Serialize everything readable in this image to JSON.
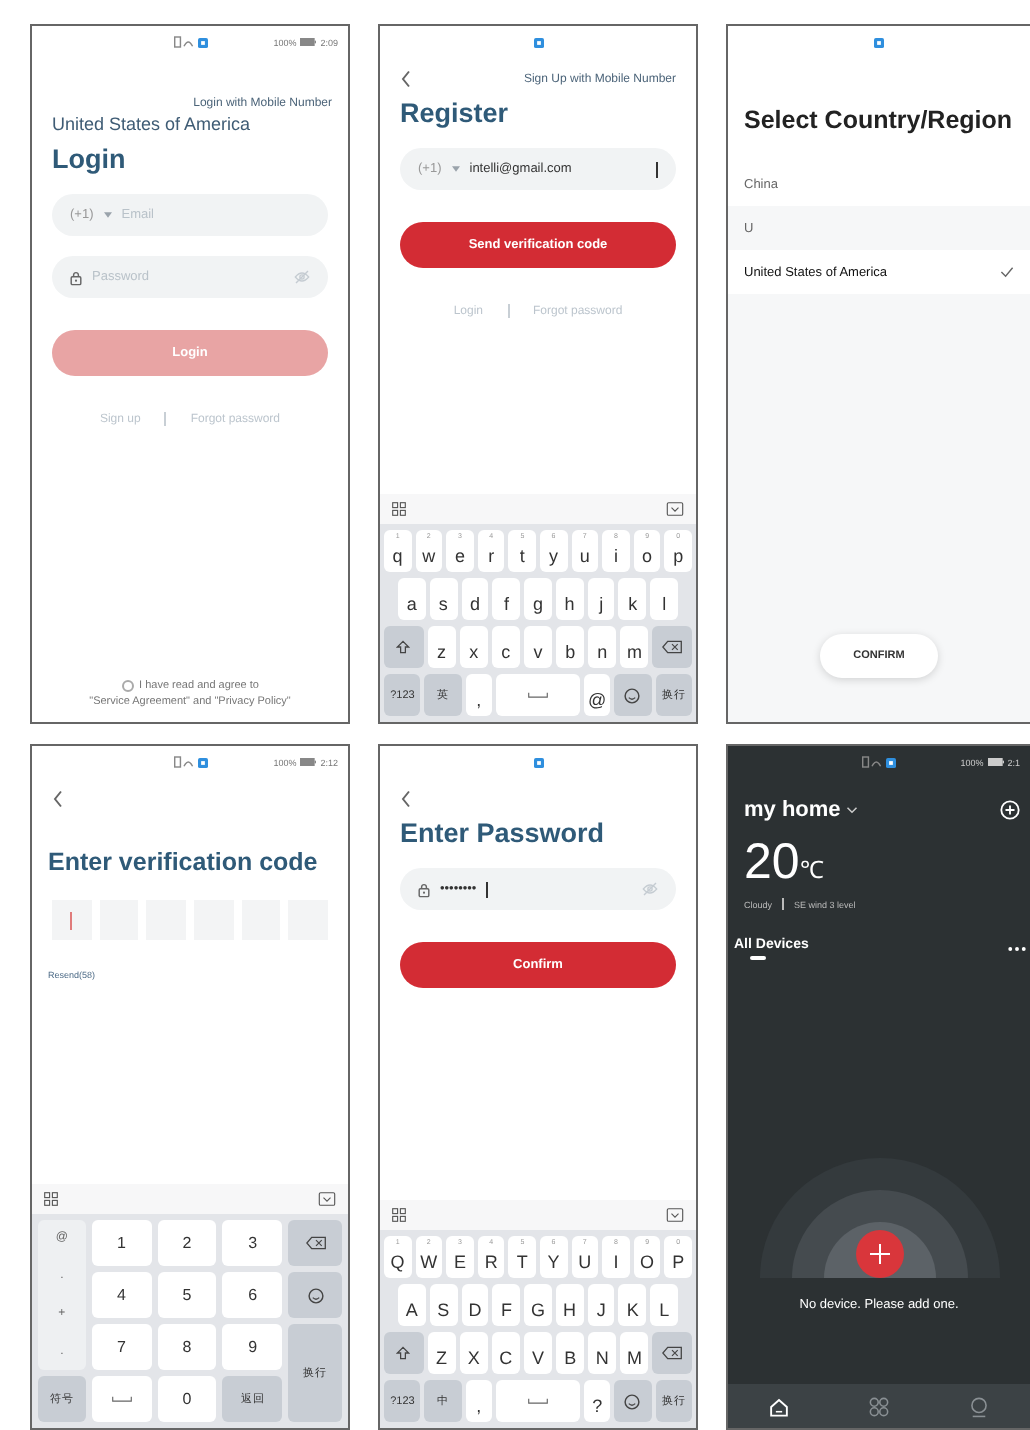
{
  "screens": [
    {
      "kind": "login",
      "status": {
        "battery": "100%",
        "time": "2:09"
      },
      "top_link": "Login with Mobile Number",
      "country": "United States of America",
      "title": "Login",
      "account_field": {
        "code": "(+1)",
        "placeholder": "Email"
      },
      "password_field": {
        "placeholder": "Password"
      },
      "button": {
        "label": "Login",
        "disabled": true
      },
      "links": [
        "Sign up",
        "Forgot password"
      ],
      "agreement": {
        "checked": false,
        "line_1": "I have read and agree to",
        "line_2": "\"Service Agreement\" and \"Privacy Policy\""
      }
    },
    {
      "kind": "register",
      "top_link": "Sign Up with Mobile Number",
      "title": "Register",
      "account_field": {
        "code": "(+1)",
        "value": "intelli@gmail.com"
      },
      "button": {
        "label": "Send verification code",
        "disabled": false
      },
      "links": [
        "Login",
        "Forgot password"
      ],
      "keyboard": {
        "kind": "letters",
        "rows": [
          {
            "keys": [
              {
                "kind": "char",
                "label": "q",
                "hint": "1"
              },
              {
                "kind": "char",
                "label": "w",
                "hint": "2"
              },
              {
                "kind": "char",
                "label": "e",
                "hint": "3"
              },
              {
                "kind": "char",
                "label": "r",
                "hint": "4"
              },
              {
                "kind": "char",
                "label": "t",
                "hint": "5"
              },
              {
                "kind": "char",
                "label": "y",
                "hint": "6"
              },
              {
                "kind": "char",
                "label": "u",
                "hint": "7"
              },
              {
                "kind": "char",
                "label": "i",
                "hint": "8"
              },
              {
                "kind": "char",
                "label": "o",
                "hint": "9"
              },
              {
                "kind": "char",
                "label": "p",
                "hint": "0"
              }
            ]
          },
          {
            "keys": [
              {
                "kind": "char",
                "label": "a"
              },
              {
                "kind": "char",
                "label": "s"
              },
              {
                "kind": "char",
                "label": "d"
              },
              {
                "kind": "char",
                "label": "f"
              },
              {
                "kind": "char",
                "label": "g"
              },
              {
                "kind": "char",
                "label": "h"
              },
              {
                "kind": "char",
                "label": "j"
              },
              {
                "kind": "char",
                "label": "k"
              },
              {
                "kind": "char",
                "label": "l"
              }
            ]
          },
          {
            "keys": [
              {
                "kind": "shift"
              },
              {
                "kind": "char",
                "label": "z"
              },
              {
                "kind": "char",
                "label": "x"
              },
              {
                "kind": "char",
                "label": "c"
              },
              {
                "kind": "char",
                "label": "v"
              },
              {
                "kind": "char",
                "label": "b"
              },
              {
                "kind": "char",
                "label": "n"
              },
              {
                "kind": "char",
                "label": "m"
              },
              {
                "kind": "backspace"
              }
            ]
          },
          {
            "keys": [
              {
                "kind": "fn",
                "label": "?123"
              },
              {
                "kind": "fn",
                "label": "英"
              },
              {
                "kind": "char",
                "label": ","
              },
              {
                "kind": "space"
              },
              {
                "kind": "char",
                "label": "@"
              },
              {
                "kind": "emoji"
              },
              {
                "kind": "fn",
                "label": "换行"
              }
            ]
          }
        ]
      }
    },
    {
      "kind": "select",
      "title": "Select Country/Region",
      "items": [
        {
          "kind": "item",
          "label": "China",
          "selected": false
        },
        {
          "kind": "header",
          "label": "U",
          "selected": false
        },
        {
          "kind": "item",
          "label": "United States of America",
          "selected": true
        }
      ],
      "button": {
        "label": "CONFIRM",
        "disabled": false
      }
    },
    {
      "kind": "verify",
      "status": {
        "battery": "100%",
        "time": "2:12"
      },
      "title": "Enter verification code",
      "boxes": [
        {
          "focused": true
        },
        {
          "focused": false
        },
        {
          "focused": false
        },
        {
          "focused": false
        },
        {
          "focused": false
        },
        {
          "focused": false
        }
      ],
      "resend": "Resend(58)",
      "keyboard": {
        "kind": "numbers",
        "symbols": [
          "@",
          ".",
          "+",
          "."
        ],
        "keys": [
          {
            "kind": "char",
            "label": "1"
          },
          {
            "kind": "char",
            "label": "2"
          },
          {
            "kind": "char",
            "label": "3"
          },
          {
            "kind": "backspace"
          },
          {
            "kind": "char",
            "label": "4"
          },
          {
            "kind": "char",
            "label": "5"
          },
          {
            "kind": "char",
            "label": "6"
          },
          {
            "kind": "emoji"
          },
          {
            "kind": "char",
            "label": "7"
          },
          {
            "kind": "char",
            "label": "8"
          },
          {
            "kind": "char",
            "label": "9"
          },
          {
            "kind": "enter",
            "label": "换行"
          },
          {
            "kind": "fn",
            "label": "符号"
          },
          {
            "kind": "space"
          },
          {
            "kind": "char",
            "label": "0"
          },
          {
            "kind": "fn",
            "label": "返回"
          }
        ]
      }
    },
    {
      "kind": "password",
      "title": "Enter Password",
      "password_field": {
        "value": "••••••••"
      },
      "button": {
        "label": "Confirm",
        "disabled": false
      },
      "keyboard": {
        "kind": "letters",
        "rows": [
          {
            "keys": [
              {
                "kind": "char",
                "label": "Q",
                "hint": "1"
              },
              {
                "kind": "char",
                "label": "W",
                "hint": "2"
              },
              {
                "kind": "char",
                "label": "E",
                "hint": "3"
              },
              {
                "kind": "char",
                "label": "R",
                "hint": "4"
              },
              {
                "kind": "char",
                "label": "T",
                "hint": "5"
              },
              {
                "kind": "char",
                "label": "Y",
                "hint": "6"
              },
              {
                "kind": "char",
                "label": "U",
                "hint": "7"
              },
              {
                "kind": "char",
                "label": "I",
                "hint": "8"
              },
              {
                "kind": "char",
                "label": "O",
                "hint": "9"
              },
              {
                "kind": "char",
                "label": "P",
                "hint": "0"
              }
            ]
          },
          {
            "keys": [
              {
                "kind": "char",
                "label": "A"
              },
              {
                "kind": "char",
                "label": "S"
              },
              {
                "kind": "char",
                "label": "D"
              },
              {
                "kind": "char",
                "label": "F"
              },
              {
                "kind": "char",
                "label": "G"
              },
              {
                "kind": "char",
                "label": "H"
              },
              {
                "kind": "char",
                "label": "J"
              },
              {
                "kind": "char",
                "label": "K"
              },
              {
                "kind": "char",
                "label": "L"
              }
            ]
          },
          {
            "keys": [
              {
                "kind": "shift"
              },
              {
                "kind": "char",
                "label": "Z"
              },
              {
                "kind": "char",
                "label": "X"
              },
              {
                "kind": "char",
                "label": "C"
              },
              {
                "kind": "char",
                "label": "V"
              },
              {
                "kind": "char",
                "label": "B"
              },
              {
                "kind": "char",
                "label": "N"
              },
              {
                "kind": "char",
                "label": "M"
              },
              {
                "kind": "backspace"
              }
            ]
          },
          {
            "keys": [
              {
                "kind": "fn",
                "label": "?123"
              },
              {
                "kind": "fn",
                "label": "中"
              },
              {
                "kind": "char",
                "label": ","
              },
              {
                "kind": "space"
              },
              {
                "kind": "char",
                "label": "?"
              },
              {
                "kind": "emoji"
              },
              {
                "kind": "fn",
                "label": "换行"
              }
            ]
          }
        ]
      }
    },
    {
      "kind": "home",
      "status": {
        "battery": "100%",
        "time": "2:1"
      },
      "home_name": "my home",
      "temperature": "20",
      "unit": "℃",
      "weather": "Cloudy",
      "wind": "SE wind 3 level",
      "tab": {
        "label": "All Devices",
        "selected": true
      },
      "empty_text": "No device. Please add one.",
      "nav": [
        {
          "kind": "home",
          "selected": true
        },
        {
          "kind": "grid",
          "selected": false
        },
        {
          "kind": "person",
          "selected": false
        }
      ]
    }
  ]
}
